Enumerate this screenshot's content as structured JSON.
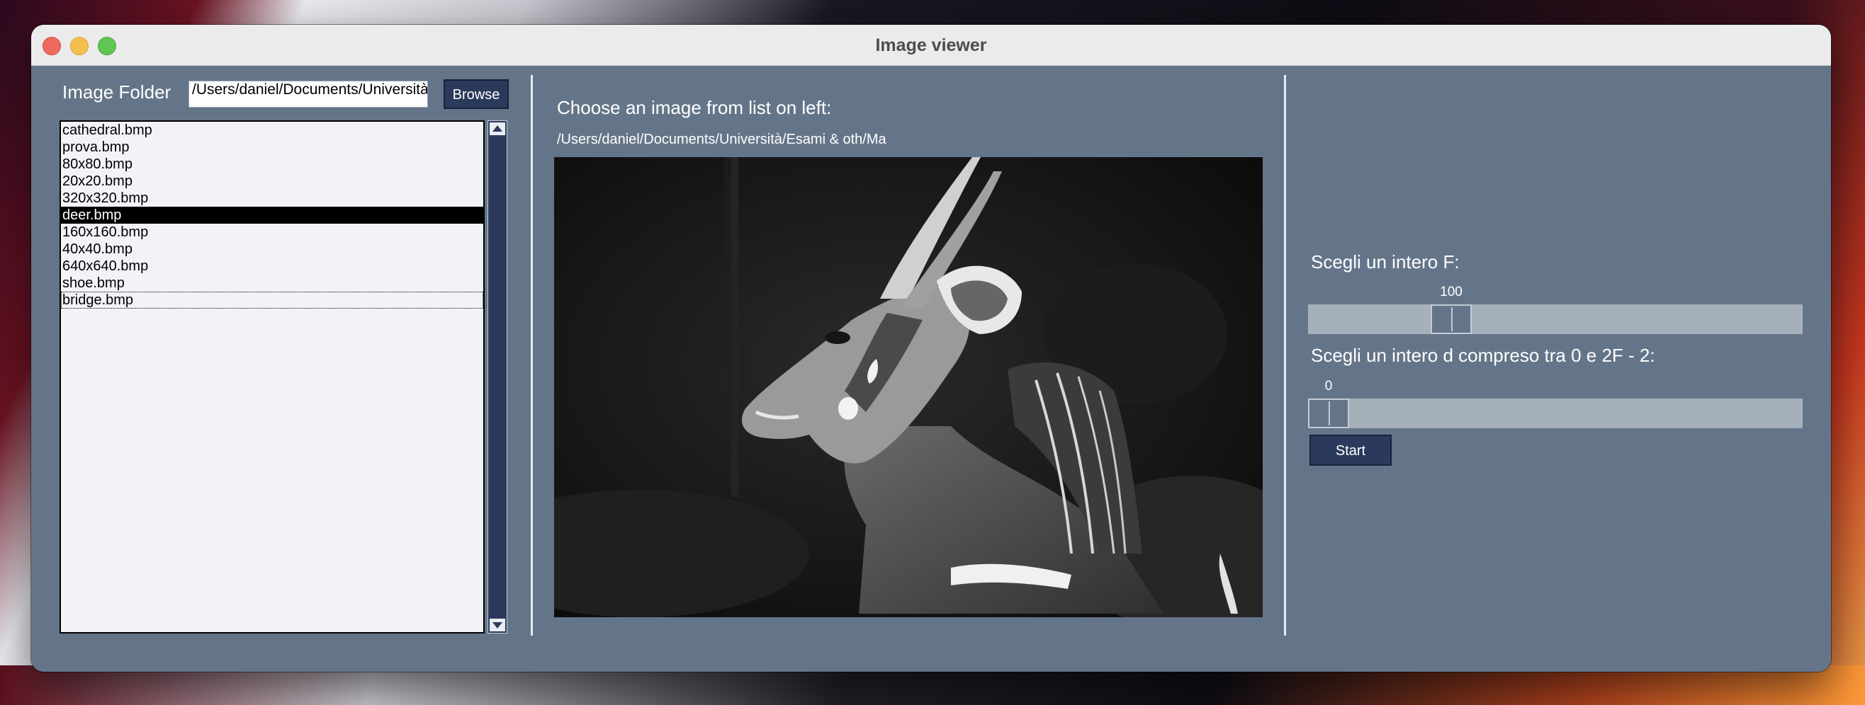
{
  "window": {
    "title": "Image viewer"
  },
  "left_panel": {
    "folder_label": "Image Folder",
    "folder_path": "/Users/daniel/Documents/Università/",
    "browse_label": "Browse",
    "files": [
      {
        "name": "cathedral.bmp"
      },
      {
        "name": "prova.bmp"
      },
      {
        "name": "80x80.bmp"
      },
      {
        "name": "20x20.bmp"
      },
      {
        "name": "320x320.bmp"
      },
      {
        "name": "deer.bmp"
      },
      {
        "name": "160x160.bmp"
      },
      {
        "name": "40x40.bmp"
      },
      {
        "name": "640x640.bmp"
      },
      {
        "name": "shoe.bmp"
      },
      {
        "name": "bridge.bmp"
      }
    ],
    "selected_file": "deer.bmp",
    "focused_file": "bridge.bmp"
  },
  "center_panel": {
    "prompt": "Choose an image from list on left:",
    "image_path": "/Users/daniel/Documents/Università/Esami & oth/Ma"
  },
  "right_panel": {
    "f_label": "Scegli un intero F:",
    "f_value": "100",
    "f_fraction": 0.27,
    "d_label": "Scegli un intero d compreso tra 0 e 2F - 2:",
    "d_value": "0",
    "d_fraction": 0.0,
    "start_label": "Start"
  },
  "colors": {
    "panel_bg": "#657589",
    "button_bg": "#2b3a5c",
    "list_bg": "#f2f3f8",
    "selection": "#000000",
    "slider_trough": "#a6b0bb"
  }
}
